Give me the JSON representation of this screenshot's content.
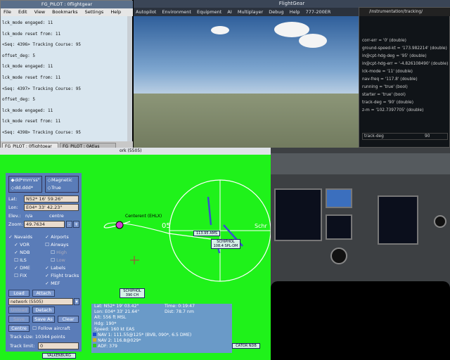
{
  "flightgear": {
    "title": "FlightGear",
    "menu": [
      "Autopilot",
      "Environment",
      "Equipment",
      "AI",
      "Multiplayer",
      "Debug",
      "Help",
      "777-200ER"
    ]
  },
  "property_browser": {
    "title": "/instrumentation/tracking/",
    "items": [
      "corr-err = '0' (double)",
      "ground-speed-kt = '173.982214' (double)",
      "in@cpt-hdg-deg = '95' (double)",
      "in@cpt-hdg-err = '-4.826108490' (double)",
      "lck-mode = '11' (double)",
      "nav-freq = '117.8' (double)",
      "running = 'true' (bool)",
      "starter = 'true' (bool)",
      "track-deg = '90' (double)",
      "z-m = '102.7397705' (double)"
    ],
    "footer_label": "track-deg",
    "footer_value": "90"
  },
  "terminal": {
    "title": "FG_PILOT : 0flightgear",
    "menu": [
      "File",
      "Edit",
      "View",
      "Bookmarks",
      "Settings",
      "Help"
    ],
    "lines": [
      "lck_mode engaged: 11",
      "lck_mode reset from: 11",
      "<Seq: 4396> Tracking Course: 95",
      "offset_deg: 5",
      "lck_mode engaged: 11",
      "lck_mode reset from: 11",
      "<Seq: 4397> Tracking Course: 95",
      "offset_deg: 5",
      "lck_mode engaged: 11",
      "lck_mode reset from: 11",
      "<Seq: 4398> Tracking Course: 95"
    ],
    "tabs": [
      "FG_PILOT : 0flightgear",
      "FG_PILOT : 0Atlas"
    ]
  },
  "atlas": {
    "title": "ork (5505)",
    "format_options": [
      "dd*mm'ss\"",
      "dd.ddd*"
    ],
    "heading_options": [
      "Magnetic",
      "True"
    ],
    "lat_label": "Lat:",
    "lat_value": "N52* 16' 59.26\"",
    "lon_label": "Lon:",
    "lon_value": "E04* 33' 42.23\"",
    "elev_label": "Elev.:",
    "elev_value": "n/a",
    "centre_label": "centre",
    "zoom_label": "Zoom:",
    "zoom_value": "49.7634",
    "zoom_minus": "-",
    "zoom_plus": "+",
    "layers_left": [
      "Navaids",
      "VOR",
      "NDB",
      "ILS",
      "DME",
      "FIX"
    ],
    "layers_right": [
      "Airports",
      "Airways",
      "High",
      "Low",
      "Labels",
      "Flight tracks",
      "MEF"
    ],
    "load_button": "Load",
    "attach_button": "Attach",
    "network": "network (5505)",
    "unload_button": "Unload",
    "detach_button": "Detach",
    "save_button": "Save",
    "save_as_button": "Save As",
    "clear_button": "Clear",
    "centre_button": "Centre",
    "follow_label": "Follow aircraft",
    "track_size": "Track size: 10344 points",
    "track_limit_label": "Track limit:",
    "track_limit_value": "0",
    "map_labels": {
      "center": "Centerent (EHLX)",
      "freq1": "113.95 AMS",
      "schiphol1": "SCHIPHOL",
      "schiphol1_freq": "108.4 SPL-DM",
      "schiphol2": "SCHIPHOL",
      "schiphol2_freq": "390 CH",
      "nav05": "05",
      "schr": "Schr",
      "ndb": "CATOR NDB",
      "valk": "VALKENBURG"
    },
    "info": {
      "lat": "Lat: N52* 19' 03.42\"",
      "time": "Time: 0:19:47",
      "lon": "Lon: E04* 33' 21.64\"",
      "dist": "Dist: 78.7 nm",
      "alt": "Alt: 556 ft MSL",
      "hdg": "Hdg: 190*",
      "speed": "Speed: 160 kt EAS",
      "nav1": "NAV 1: 111.55@125* (BVB, 090*, 6.5 DME)",
      "nav2": "NAV 2: 116.8@029*",
      "adf": "ADF: 379"
    }
  },
  "colors": {
    "map_green": "#1ff21a",
    "panel_blue": "#5a7cb8",
    "info_blue": "#6a9ac8",
    "track_magenta": "#d03cd0"
  }
}
